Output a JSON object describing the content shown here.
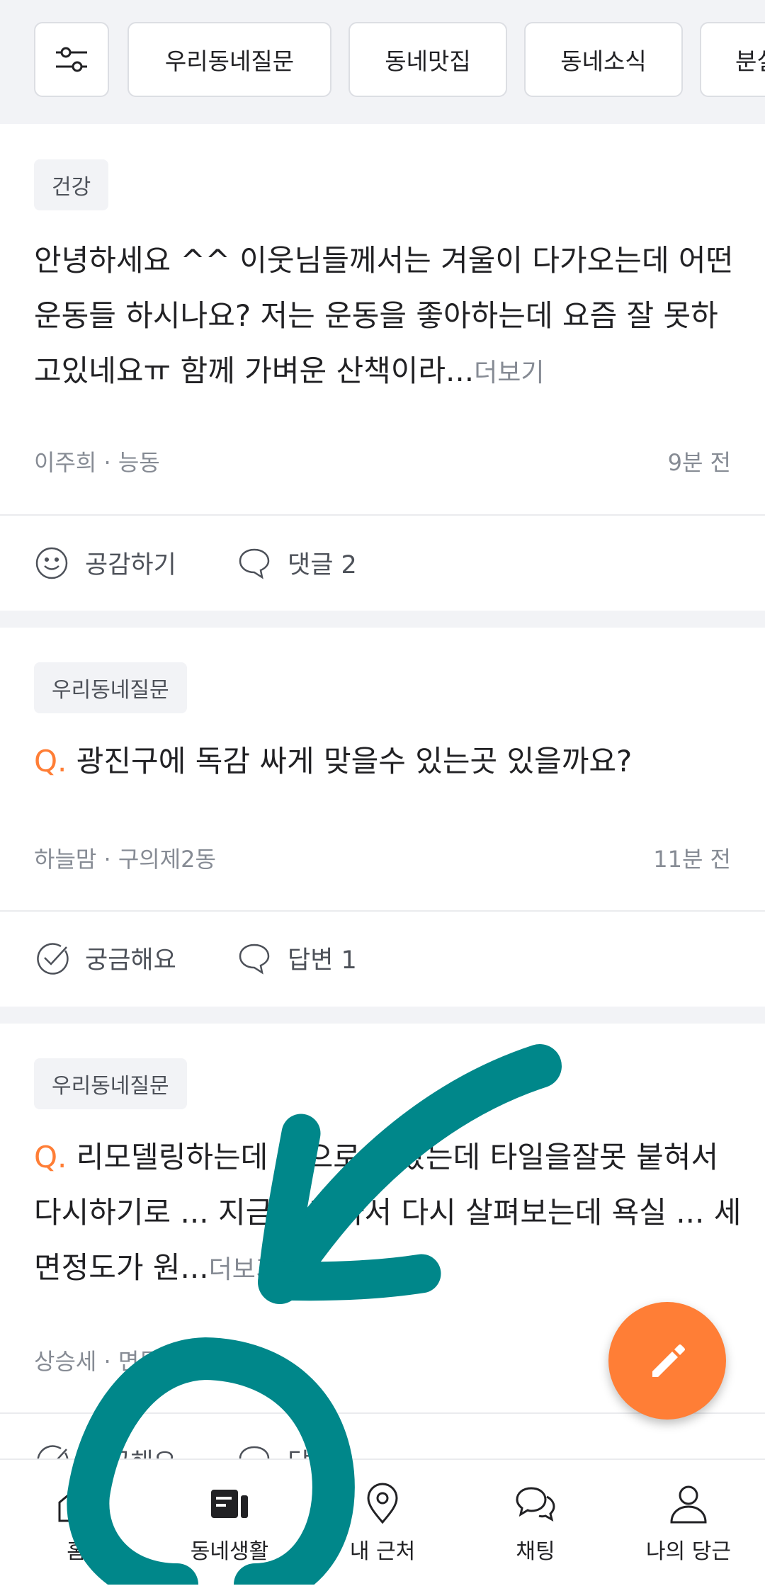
{
  "filters": {
    "filter_icon": "sliders-icon",
    "items": [
      "우리동네질문",
      "동네맛집",
      "동네소식",
      "분실"
    ]
  },
  "posts": [
    {
      "tag": "건강",
      "question_prefix": "",
      "text": "안녕하세요 ^^ 이웃님들께서는 겨울이 다가오는데 어떤 운동들 하시나요? 저는 운동을 좋아하는데 요즘 잘 못하고있네요ㅠ 함께 가벼운 산책이라...",
      "more": "더보기",
      "author": "이주희",
      "location": "능동",
      "time": "9분 전",
      "action1": "공감하기",
      "action2": "댓글 2"
    },
    {
      "tag": "우리동네질문",
      "question_prefix": "Q.",
      "text": "광진구에 독감 싸게 맞을수 있는곳 있을까요?",
      "more": "",
      "author": "하늘맘",
      "location": "구의제2동",
      "time": "11분 전",
      "action1": "궁금해요",
      "action2": "답변 1"
    },
    {
      "tag": "우리동네질문",
      "question_prefix": "Q.",
      "text": "리모델링하는데 ...으로 ...봤는데 타일을잘못 붙혀서 다시하기로 ... 지금 혼자와서 다시 살펴보는데 욕실 ... 세면정도가 원...",
      "more": "더보기",
      "author": "상승세",
      "location": "면목동",
      "time": "",
      "action1": "궁금해요",
      "action2": "답변"
    }
  ],
  "separator": "·",
  "fab": {
    "icon": "pencil-icon"
  },
  "bottom_nav": [
    {
      "label": "홈",
      "icon": "home-icon"
    },
    {
      "label": "동네생활",
      "icon": "community-icon"
    },
    {
      "label": "내 근처",
      "icon": "location-pin-icon"
    },
    {
      "label": "채팅",
      "icon": "chat-icon"
    },
    {
      "label": "나의 당근",
      "icon": "profile-icon"
    }
  ],
  "colors": {
    "accent": "#ff7e36",
    "annotation": "#00878a",
    "background_band": "#f2f3f6",
    "text_secondary": "#868b94"
  }
}
